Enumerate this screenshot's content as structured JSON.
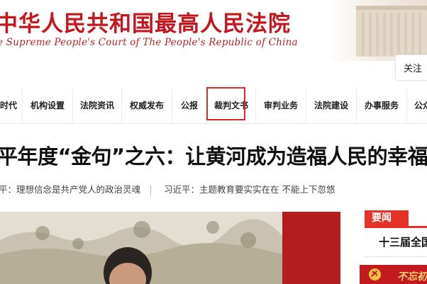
{
  "header": {
    "title": "中华人民共和国最高人民法院",
    "subtitle": "e Supreme People's Court of The People's Republic of China",
    "follow_label": "关注"
  },
  "nav": {
    "items": [
      {
        "label": "时代"
      },
      {
        "label": "机构设置"
      },
      {
        "label": "法院资讯"
      },
      {
        "label": "权威发布"
      },
      {
        "label": "公报"
      },
      {
        "label": "裁判文书"
      },
      {
        "label": "审判业务"
      },
      {
        "label": "法院建设"
      },
      {
        "label": "办事服务"
      },
      {
        "label": "公众"
      }
    ],
    "highlighted_index": 5
  },
  "headline": {
    "title": "平年度“金句”之六：让黄河成为造福人民的幸福河",
    "sublinks": [
      "平：理想信念是共产党人的政治灵魂",
      "习近平：主题教育要实实在在 不能上下忽悠"
    ]
  },
  "sidebar": {
    "news_tab_label": "要闻",
    "first_news": "十三届全国",
    "party_banner_text": "不忘初"
  },
  "colors": {
    "brand_red": "#c4161c",
    "tab_red": "#e4322b",
    "highlight_border": "#e0262a"
  }
}
